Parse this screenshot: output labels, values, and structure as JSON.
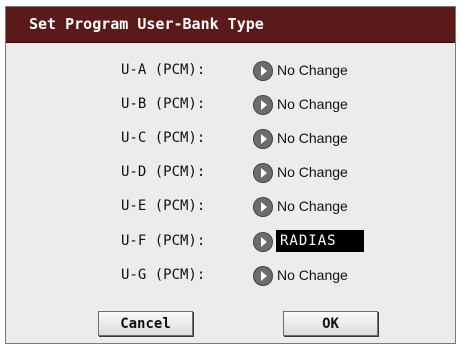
{
  "dialog": {
    "title": "Set Program User-Bank Type"
  },
  "rows": [
    {
      "label": "U-A (PCM):",
      "value": "No Change",
      "selected": false
    },
    {
      "label": "U-B (PCM):",
      "value": "No Change",
      "selected": false
    },
    {
      "label": "U-C (PCM):",
      "value": "No Change",
      "selected": false
    },
    {
      "label": "U-D (PCM):",
      "value": "No Change",
      "selected": false
    },
    {
      "label": "U-E (PCM):",
      "value": "No Change",
      "selected": false
    },
    {
      "label": "U-F (PCM):",
      "value": "RADIAS",
      "selected": true
    },
    {
      "label": "U-G (PCM):",
      "value": "No Change",
      "selected": false
    }
  ],
  "buttons": {
    "cancel_label": "Cancel",
    "ok_label": "OK"
  },
  "icons": {
    "popup_arrow": "chevron-right-icon"
  },
  "colors": {
    "title_bar": "#5a1a1a",
    "dialog_bg": "#ececec",
    "selected_bg": "#000000",
    "selected_fg": "#ffffff",
    "arrow_button": "#6c6c6c"
  }
}
